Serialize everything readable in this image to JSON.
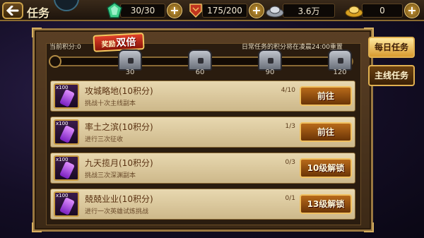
{
  "header": {
    "title": "任务",
    "resources": [
      {
        "name": "stamina",
        "value": "30/30",
        "icon": "green-crystal-icon",
        "color": "#3fd08a"
      },
      {
        "name": "honor",
        "value": "175/200",
        "icon": "red-emblem-icon",
        "color": "#d0402a"
      },
      {
        "name": "silver",
        "value": "3.6万",
        "icon": "silver-ingot-icon",
        "color": "#c0c4cc"
      },
      {
        "name": "gold",
        "value": "0",
        "icon": "gold-ingot-icon",
        "color": "#e8b030"
      }
    ],
    "plus_label": "+"
  },
  "progress": {
    "score_label": "当前积分:0",
    "bonus_badge_small": "奖励",
    "bonus_badge_big": "双倍",
    "reset_note": "日常任务的积分将在凌晨24:00重置",
    "fill_fraction": 0,
    "milestones": [
      "30",
      "60",
      "90",
      "120"
    ]
  },
  "tasks": [
    {
      "qty": "x100",
      "name": "攻城略地(10积分)",
      "desc": "挑战十次主线副本",
      "progress": "4/10",
      "button": "前往"
    },
    {
      "qty": "x100",
      "name": "率土之滨(10积分)",
      "desc": "进行三次征收",
      "progress": "1/3",
      "button": "前往"
    },
    {
      "qty": "x100",
      "name": "九天揽月(10积分)",
      "desc": "挑战三次深渊副本",
      "progress": "0/3",
      "button": "10级解锁"
    },
    {
      "qty": "x100",
      "name": "兢兢业业(10积分)",
      "desc": "进行一次英雄试炼挑战",
      "progress": "0/1",
      "button": "13级解锁"
    }
  ],
  "side_tabs": [
    {
      "label": "每日任务",
      "active": true
    },
    {
      "label": "主线任务",
      "active": false
    }
  ]
}
